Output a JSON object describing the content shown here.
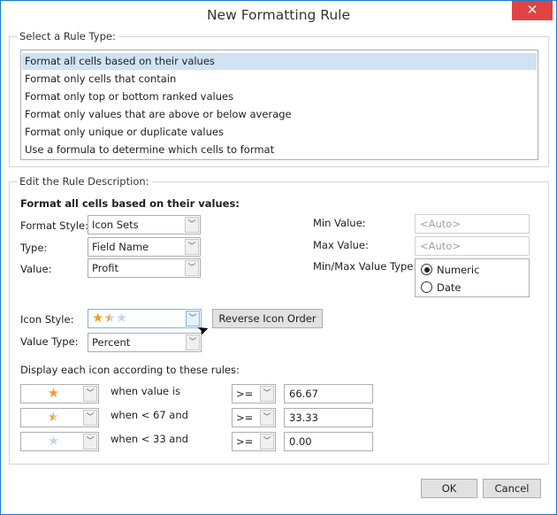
{
  "window": {
    "title": "New Formatting Rule",
    "close_icon": "close-icon"
  },
  "rule_type": {
    "legend": "Select a Rule Type:",
    "items": [
      "Format all cells based on their values",
      "Format only cells that contain",
      "Format only top or bottom ranked values",
      "Format only values that are above or below average",
      "Format only unique or duplicate values",
      "Use a formula to determine which cells to format"
    ],
    "selected_index": 0
  },
  "description": {
    "legend": "Edit the Rule Description:",
    "heading": "Format all cells based on their values:",
    "format_style_label": "Format Style:",
    "format_style": "Icon Sets",
    "type_label": "Type:",
    "type": "Field Name",
    "value_label": "Value:",
    "value": "Profit",
    "min_value_label": "Min Value:",
    "min_value_placeholder": "<Auto>",
    "max_value_label": "Max Value:",
    "max_value_placeholder": "<Auto>",
    "minmax_type_label": "Min/Max Value Type:",
    "minmax_options": [
      "Numeric",
      "Date"
    ],
    "minmax_selected": "Numeric",
    "icon_style_label": "Icon Style:",
    "icon_style": "3 stars",
    "reverse_label": "Reverse Icon Order",
    "value_type_label": "Value Type:",
    "value_type": "Percent",
    "display_rules_label": "Display each icon according to these rules:",
    "rules": [
      {
        "icon": "star-full",
        "text": "when value is",
        "op": ">=",
        "value": "66.67"
      },
      {
        "icon": "star-half",
        "text": "when < 67 and",
        "op": ">=",
        "value": "33.33"
      },
      {
        "icon": "star-empty",
        "text": "when < 33 and",
        "op": ">=",
        "value": "0.00"
      }
    ]
  },
  "buttons": {
    "ok": "OK",
    "cancel": "Cancel"
  },
  "colors": {
    "accent": "#1979ca",
    "selection": "#cfe3f4",
    "close": "#e04343",
    "star": "#f0a030"
  }
}
